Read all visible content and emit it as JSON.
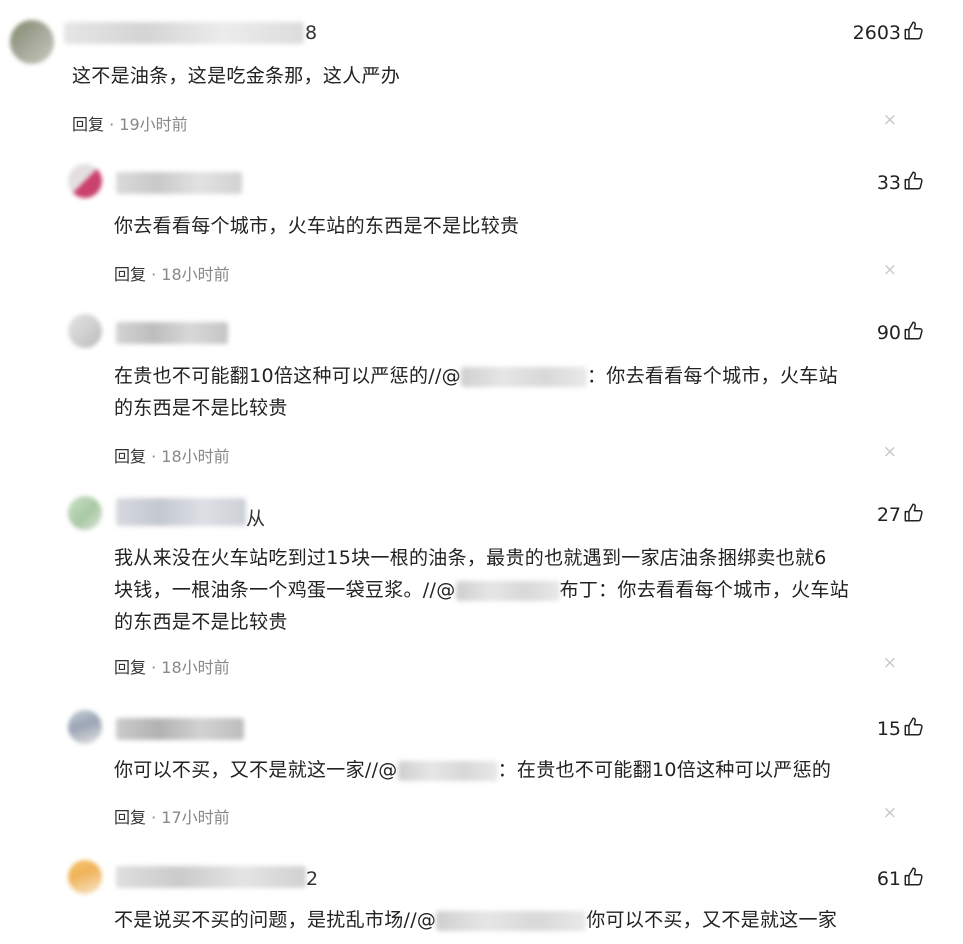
{
  "comments": [
    {
      "name_suffix": "8",
      "likes": "2603",
      "text": [
        "这不是油条，这是吃金条那，这人严办"
      ],
      "reply_label": "回复",
      "time": "19小时前",
      "close": "×"
    },
    {
      "name_suffix": "",
      "likes": "33",
      "text": [
        "你去看看每个城市，火车站的东西是不是比较贵"
      ],
      "reply_label": "回复",
      "time": "18小时前",
      "close": "×"
    },
    {
      "name_suffix": "",
      "likes": "90",
      "text_a": "在贵也不可能翻10倍这种可以严惩的//@",
      "text_b": "：你去看看每个城市，火车站",
      "text_c": "的东西是不是比较贵",
      "reply_label": "回复",
      "time": "18小时前",
      "close": "×"
    },
    {
      "name_suffix": "从",
      "likes": "27",
      "text_a": "我从来没在火车站吃到过15块一根的油条，最贵的也就遇到一家店油条捆绑卖也就6",
      "text_b": "块钱，一根油条一个鸡蛋一袋豆浆。//@",
      "text_c": "布丁：你去看看每个城市，火车站",
      "text_d": "的东西是不是比较贵",
      "reply_label": "回复",
      "time": "18小时前",
      "close": "×"
    },
    {
      "name_suffix": "",
      "likes": "15",
      "text_a": "你可以不买，又不是就这一家//@",
      "text_b": "：在贵也不可能翻10倍这种可以严惩的",
      "reply_label": "回复",
      "time": "17小时前",
      "close": "×"
    },
    {
      "name_suffix": "2",
      "likes": "61",
      "text_a": "不是说买不买的问题，是扰乱市场//@",
      "text_b": "你可以不买，又不是就这一家",
      "reply_label": "",
      "time": "",
      "close": ""
    }
  ],
  "icons": {
    "like": "thumbs-up-icon",
    "close": "close-icon"
  },
  "colors": {
    "text": "#222222",
    "meta": "#888888",
    "close": "#c8c8c8"
  }
}
